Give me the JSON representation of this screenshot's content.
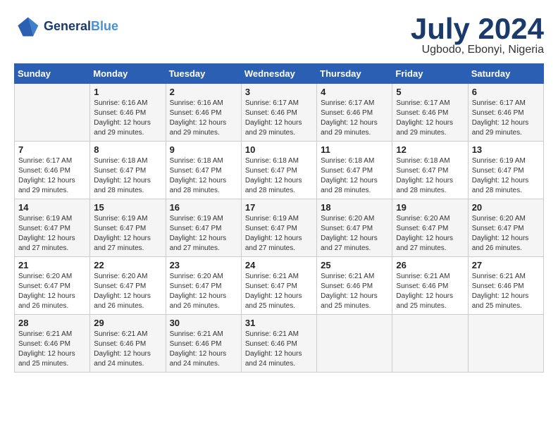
{
  "header": {
    "logo_line1": "General",
    "logo_line2": "Blue",
    "month": "July 2024",
    "location": "Ugbodo, Ebonyi, Nigeria"
  },
  "days_of_week": [
    "Sunday",
    "Monday",
    "Tuesday",
    "Wednesday",
    "Thursday",
    "Friday",
    "Saturday"
  ],
  "weeks": [
    [
      {
        "day": "",
        "info": ""
      },
      {
        "day": "1",
        "info": "Sunrise: 6:16 AM\nSunset: 6:46 PM\nDaylight: 12 hours\nand 29 minutes."
      },
      {
        "day": "2",
        "info": "Sunrise: 6:16 AM\nSunset: 6:46 PM\nDaylight: 12 hours\nand 29 minutes."
      },
      {
        "day": "3",
        "info": "Sunrise: 6:17 AM\nSunset: 6:46 PM\nDaylight: 12 hours\nand 29 minutes."
      },
      {
        "day": "4",
        "info": "Sunrise: 6:17 AM\nSunset: 6:46 PM\nDaylight: 12 hours\nand 29 minutes."
      },
      {
        "day": "5",
        "info": "Sunrise: 6:17 AM\nSunset: 6:46 PM\nDaylight: 12 hours\nand 29 minutes."
      },
      {
        "day": "6",
        "info": "Sunrise: 6:17 AM\nSunset: 6:46 PM\nDaylight: 12 hours\nand 29 minutes."
      }
    ],
    [
      {
        "day": "7",
        "info": "Sunrise: 6:17 AM\nSunset: 6:46 PM\nDaylight: 12 hours\nand 29 minutes."
      },
      {
        "day": "8",
        "info": "Sunrise: 6:18 AM\nSunset: 6:47 PM\nDaylight: 12 hours\nand 28 minutes."
      },
      {
        "day": "9",
        "info": "Sunrise: 6:18 AM\nSunset: 6:47 PM\nDaylight: 12 hours\nand 28 minutes."
      },
      {
        "day": "10",
        "info": "Sunrise: 6:18 AM\nSunset: 6:47 PM\nDaylight: 12 hours\nand 28 minutes."
      },
      {
        "day": "11",
        "info": "Sunrise: 6:18 AM\nSunset: 6:47 PM\nDaylight: 12 hours\nand 28 minutes."
      },
      {
        "day": "12",
        "info": "Sunrise: 6:18 AM\nSunset: 6:47 PM\nDaylight: 12 hours\nand 28 minutes."
      },
      {
        "day": "13",
        "info": "Sunrise: 6:19 AM\nSunset: 6:47 PM\nDaylight: 12 hours\nand 28 minutes."
      }
    ],
    [
      {
        "day": "14",
        "info": "Sunrise: 6:19 AM\nSunset: 6:47 PM\nDaylight: 12 hours\nand 27 minutes."
      },
      {
        "day": "15",
        "info": "Sunrise: 6:19 AM\nSunset: 6:47 PM\nDaylight: 12 hours\nand 27 minutes."
      },
      {
        "day": "16",
        "info": "Sunrise: 6:19 AM\nSunset: 6:47 PM\nDaylight: 12 hours\nand 27 minutes."
      },
      {
        "day": "17",
        "info": "Sunrise: 6:19 AM\nSunset: 6:47 PM\nDaylight: 12 hours\nand 27 minutes."
      },
      {
        "day": "18",
        "info": "Sunrise: 6:20 AM\nSunset: 6:47 PM\nDaylight: 12 hours\nand 27 minutes."
      },
      {
        "day": "19",
        "info": "Sunrise: 6:20 AM\nSunset: 6:47 PM\nDaylight: 12 hours\nand 27 minutes."
      },
      {
        "day": "20",
        "info": "Sunrise: 6:20 AM\nSunset: 6:47 PM\nDaylight: 12 hours\nand 26 minutes."
      }
    ],
    [
      {
        "day": "21",
        "info": "Sunrise: 6:20 AM\nSunset: 6:47 PM\nDaylight: 12 hours\nand 26 minutes."
      },
      {
        "day": "22",
        "info": "Sunrise: 6:20 AM\nSunset: 6:47 PM\nDaylight: 12 hours\nand 26 minutes."
      },
      {
        "day": "23",
        "info": "Sunrise: 6:20 AM\nSunset: 6:47 PM\nDaylight: 12 hours\nand 26 minutes."
      },
      {
        "day": "24",
        "info": "Sunrise: 6:21 AM\nSunset: 6:47 PM\nDaylight: 12 hours\nand 25 minutes."
      },
      {
        "day": "25",
        "info": "Sunrise: 6:21 AM\nSunset: 6:46 PM\nDaylight: 12 hours\nand 25 minutes."
      },
      {
        "day": "26",
        "info": "Sunrise: 6:21 AM\nSunset: 6:46 PM\nDaylight: 12 hours\nand 25 minutes."
      },
      {
        "day": "27",
        "info": "Sunrise: 6:21 AM\nSunset: 6:46 PM\nDaylight: 12 hours\nand 25 minutes."
      }
    ],
    [
      {
        "day": "28",
        "info": "Sunrise: 6:21 AM\nSunset: 6:46 PM\nDaylight: 12 hours\nand 25 minutes."
      },
      {
        "day": "29",
        "info": "Sunrise: 6:21 AM\nSunset: 6:46 PM\nDaylight: 12 hours\nand 24 minutes."
      },
      {
        "day": "30",
        "info": "Sunrise: 6:21 AM\nSunset: 6:46 PM\nDaylight: 12 hours\nand 24 minutes."
      },
      {
        "day": "31",
        "info": "Sunrise: 6:21 AM\nSunset: 6:46 PM\nDaylight: 12 hours\nand 24 minutes."
      },
      {
        "day": "",
        "info": ""
      },
      {
        "day": "",
        "info": ""
      },
      {
        "day": "",
        "info": ""
      }
    ]
  ]
}
